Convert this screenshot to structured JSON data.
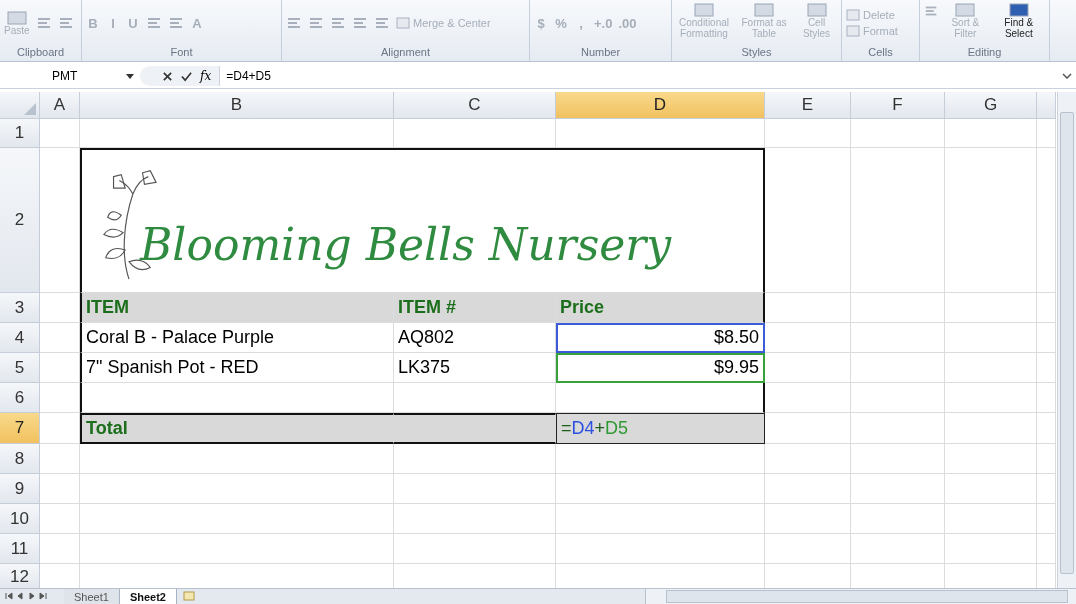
{
  "ribbon": {
    "groups": [
      {
        "label": "Clipboard",
        "items": [
          {
            "kind": "large",
            "label": "Paste",
            "disabled": true
          },
          {
            "kind": "icon",
            "disabled": true
          },
          {
            "kind": "icon",
            "disabled": true
          }
        ]
      },
      {
        "label": "Font",
        "items": [
          {
            "kind": "glyph",
            "label": "B",
            "disabled": true
          },
          {
            "kind": "glyph",
            "label": "I",
            "disabled": true
          },
          {
            "kind": "glyph",
            "label": "U",
            "disabled": true
          },
          {
            "kind": "icon",
            "disabled": true
          },
          {
            "kind": "icon",
            "disabled": true
          },
          {
            "kind": "glyph",
            "label": "A",
            "disabled": true
          }
        ]
      },
      {
        "label": "Alignment",
        "items": [
          {
            "kind": "icon",
            "disabled": true
          },
          {
            "kind": "icon",
            "disabled": true
          },
          {
            "kind": "icon",
            "disabled": true
          },
          {
            "kind": "icon",
            "disabled": true
          },
          {
            "kind": "icon",
            "disabled": true
          },
          {
            "kind": "small",
            "label": "Merge & Center",
            "disabled": true
          }
        ]
      },
      {
        "label": "Number",
        "items": [
          {
            "kind": "glyph",
            "label": "$",
            "disabled": true
          },
          {
            "kind": "glyph",
            "label": "%",
            "disabled": true
          },
          {
            "kind": "glyph",
            "label": ",",
            "disabled": true
          },
          {
            "kind": "glyph",
            "label": "+.0",
            "disabled": true
          },
          {
            "kind": "glyph",
            "label": ".00",
            "disabled": true
          }
        ]
      },
      {
        "label": "Styles",
        "items": [
          {
            "kind": "large",
            "label": "Conditional Formatting",
            "disabled": true
          },
          {
            "kind": "large",
            "label": "Format as Table",
            "disabled": true
          },
          {
            "kind": "large",
            "label": "Cell Styles",
            "disabled": true
          }
        ]
      },
      {
        "label": "Cells",
        "items": [
          {
            "kind": "small",
            "label": "Delete",
            "disabled": true
          },
          {
            "kind": "small",
            "label": "Format",
            "disabled": true
          }
        ]
      },
      {
        "label": "Editing",
        "items": [
          {
            "kind": "icon",
            "disabled": true
          },
          {
            "kind": "large",
            "label": "Sort & Filter",
            "disabled": true
          },
          {
            "kind": "large",
            "label": "Find & Select",
            "disabled": false
          }
        ]
      }
    ]
  },
  "formula_bar": {
    "name_box": "PMT",
    "fx": "fx",
    "formula": "=D4+D5"
  },
  "columns": [
    {
      "label": "A",
      "selected": false
    },
    {
      "label": "B",
      "selected": false
    },
    {
      "label": "C",
      "selected": false
    },
    {
      "label": "D",
      "selected": true
    },
    {
      "label": "E",
      "selected": false
    },
    {
      "label": "F",
      "selected": false
    },
    {
      "label": "G",
      "selected": false
    }
  ],
  "rows": [
    {
      "number": "1",
      "selected": false,
      "kind": "empty"
    },
    {
      "number": "2",
      "selected": false,
      "kind": "banner",
      "title": "Blooming Bells Nursery"
    },
    {
      "number": "3",
      "selected": false,
      "kind": "header",
      "cells": [
        {
          "text": "ITEM"
        },
        {
          "text": "ITEM #"
        },
        {
          "text": "Price"
        }
      ]
    },
    {
      "number": "4",
      "selected": false,
      "kind": "data",
      "cells": [
        {
          "text": "Coral B - Palace Purple"
        },
        {
          "text": "AQ802"
        },
        {
          "text": "$8.50",
          "color": "#3b5bdb"
        }
      ]
    },
    {
      "number": "5",
      "selected": false,
      "kind": "data",
      "cells": [
        {
          "text": "7\" Spanish Pot - RED"
        },
        {
          "text": "LK375"
        },
        {
          "text": "$9.95",
          "color": "#37a13a"
        }
      ]
    },
    {
      "number": "6",
      "selected": false,
      "kind": "spacer"
    },
    {
      "number": "7",
      "selected": true,
      "kind": "total",
      "cells": [
        {
          "text": "Total"
        }
      ],
      "formula": [
        {
          "text": "=",
          "color": "#1a5e1a"
        },
        {
          "text": "D4",
          "color": "#2b4fe0"
        },
        {
          "text": "+",
          "color": "#1a5e1a"
        },
        {
          "text": "D5",
          "color": "#2f9a31"
        }
      ]
    },
    {
      "number": "8",
      "selected": false,
      "kind": "empty"
    },
    {
      "number": "9",
      "selected": false,
      "kind": "empty"
    },
    {
      "number": "10",
      "selected": false,
      "kind": "empty"
    },
    {
      "number": "11",
      "selected": false,
      "kind": "empty"
    },
    {
      "number": "12",
      "selected": false,
      "kind": "empty"
    }
  ],
  "sheet_tabs": [
    {
      "label": "Sheet1",
      "selected": false
    },
    {
      "label": "Sheet2",
      "selected": true
    }
  ]
}
